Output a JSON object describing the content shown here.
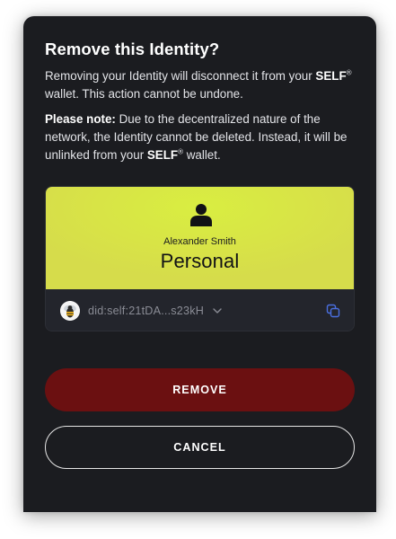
{
  "dialog": {
    "title": "Remove this Identity?",
    "paragraph1": {
      "before": "Removing your Identity will disconnect it from your ",
      "brand": "SELF",
      "reg": "®",
      "after": " wallet. This action cannot be undone."
    },
    "paragraph2": {
      "label": "Please note:",
      "before": " Due to the decentralized nature of the network, the Identity cannot be deleted. Instead, it will be unlinked from your ",
      "brand": "SELF",
      "reg": "®",
      "after": " wallet."
    }
  },
  "identity_card": {
    "holder_name": "Alexander Smith",
    "type": "Personal",
    "did": "did:self:21tDA...s23kH",
    "card_color": "#d8e446",
    "icons": {
      "person": "person-icon",
      "avatar": "bee-avatar",
      "expand": "chevron-down-icon",
      "copy": "copy-icon"
    }
  },
  "actions": {
    "remove_label": "REMOVE",
    "cancel_label": "CANCEL",
    "remove_color": "#6b1011"
  }
}
